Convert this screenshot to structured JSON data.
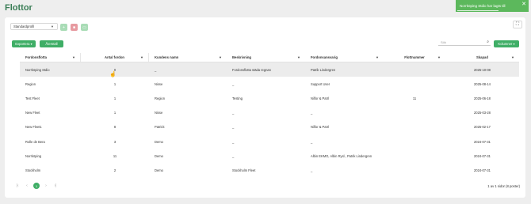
{
  "page": {
    "title": "Flottor"
  },
  "toast": {
    "message": "Norrköping Stdio har lagts till",
    "close": "✕"
  },
  "toolbar": {
    "profile": "Standardprofil",
    "export_label": "Exportera ▾",
    "reset_label": "Återställ",
    "columns_label": "Kolumner ▾",
    "search_placeholder": "Sök",
    "fullscreen": "⛶"
  },
  "table": {
    "columns": [
      "Fordonsflotta",
      "Antal fordon",
      "Kundens namn",
      "Beskrivning",
      "Fordonsansvarig",
      "Flottnummer",
      "Skapad"
    ],
    "rows": [
      [
        "Norrköping Stdio",
        "0",
        "_",
        "Fordonsflotta städa regnan",
        "Patrik Lindergren",
        "",
        "2025-10-08"
      ],
      [
        "Region",
        "1",
        "Nisse",
        "_",
        "Support User",
        "",
        "2025-08-14"
      ],
      [
        "Test Fleet",
        "1",
        "Region",
        "Testing",
        "Nilfor & Patrl",
        "11",
        "2025-06-18"
      ],
      [
        "New Fleet",
        "1",
        "Nisse",
        "_",
        "_",
        "",
        "2025-03-28"
      ],
      [
        "New Fleet1",
        "8",
        "Patrick",
        "_",
        "Nilfor & Patrl",
        "",
        "2025-02-17"
      ],
      [
        "Rolle de Bera",
        "3",
        "Demo",
        "_",
        "_",
        "",
        "2024-07-31"
      ],
      [
        "Norrköping",
        "11",
        "Demo",
        "_",
        "Albin EKMO, Albin Rysl., Patrik Lindergren",
        "",
        "2024-07-31"
      ],
      [
        "Stockholm",
        "2",
        "Demo",
        "Stockholm Fleet",
        "_",
        "",
        "2024-07-31"
      ]
    ]
  },
  "pager": {
    "first": "|‹",
    "prev": "‹",
    "page": "1",
    "next": "›",
    "last": "›|",
    "info": "1 av 1 sidor (8 poster)"
  }
}
